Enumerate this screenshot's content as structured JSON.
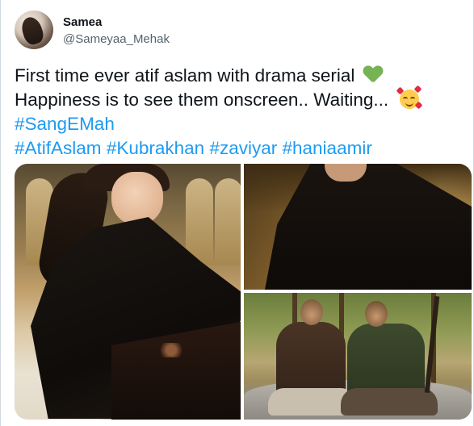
{
  "author": {
    "display_name": "Samea",
    "handle": "@Sameyaa_Mehak"
  },
  "tweet": {
    "line1": "First time ever atif aslam with drama serial",
    "line1_emoji": "green-heart-icon",
    "line2": "Happiness is to see them onscreen.. Waiting...",
    "line2_emoji": "smiling-face-with-hearts-icon",
    "hashtag1": "#SangEMah",
    "hashtags_line": [
      "#AtifAslam",
      "#Kubrakhan",
      "#zaviyar",
      "#haniaamir"
    ]
  },
  "colors": {
    "text": "#0f1419",
    "secondary": "#536471",
    "link": "#1d9bf0",
    "border": "#cfd9de"
  }
}
